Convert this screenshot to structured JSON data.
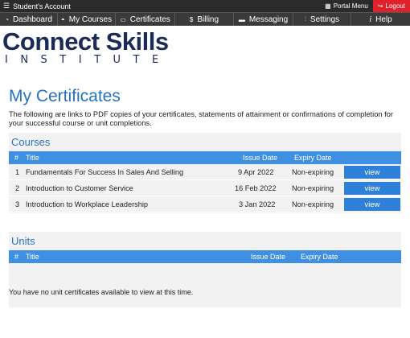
{
  "topbar": {
    "title": "Student's Account",
    "portal_menu": "Portal Menu",
    "logout": "Logout"
  },
  "nav": [
    {
      "icon": "dashboard-icon",
      "glyph": "◔",
      "label": "Dashboard"
    },
    {
      "icon": "courses-icon",
      "glyph": "◓",
      "label": "My Courses"
    },
    {
      "icon": "certificate-icon",
      "glyph": "▭",
      "label": "Certificates"
    },
    {
      "icon": "billing-icon",
      "glyph": "$",
      "label": "Billing"
    },
    {
      "icon": "message-icon",
      "glyph": "▬",
      "label": "Messaging"
    },
    {
      "icon": "settings-icon",
      "glyph": "⫶",
      "label": "Settings"
    },
    {
      "icon": "help-icon",
      "glyph": "i",
      "label": "Help"
    }
  ],
  "logo": {
    "line1": "Connect Skills",
    "line2": "INSTITUTE"
  },
  "page": {
    "title": "My Certificates",
    "intro": "The following are links to PDF copies of your certificates, statements of attainment or confirmations of completion for your successful course or unit completions."
  },
  "courses": {
    "heading": "Courses",
    "columns": {
      "num": "#",
      "title": "Title",
      "issue": "Issue Date",
      "expiry": "Expiry Date"
    },
    "rows": [
      {
        "num": "1",
        "title": "Fundamentals For Success In Sales And Selling",
        "issue": "9 Apr 2022",
        "expiry": "Non-expiring",
        "action": "view"
      },
      {
        "num": "2",
        "title": "Introduction to Customer Service",
        "issue": "16 Feb 2022",
        "expiry": "Non-expiring",
        "action": "view"
      },
      {
        "num": "3",
        "title": "Introduction to Workplace Leadership",
        "issue": "3 Jan 2022",
        "expiry": "Non-expiring",
        "action": "view"
      }
    ]
  },
  "units": {
    "heading": "Units",
    "columns": {
      "num": "#",
      "title": "Title",
      "issue": "Issue Date",
      "expiry": "Expiry Date"
    },
    "empty_message": "You have no unit certificates available to view at this time."
  },
  "colors": {
    "accent": "#2572c2",
    "table_header": "#3f8fe3",
    "button": "#2f80d8",
    "logout": "#e0202a",
    "nav_bg": "#3a3a3a"
  }
}
